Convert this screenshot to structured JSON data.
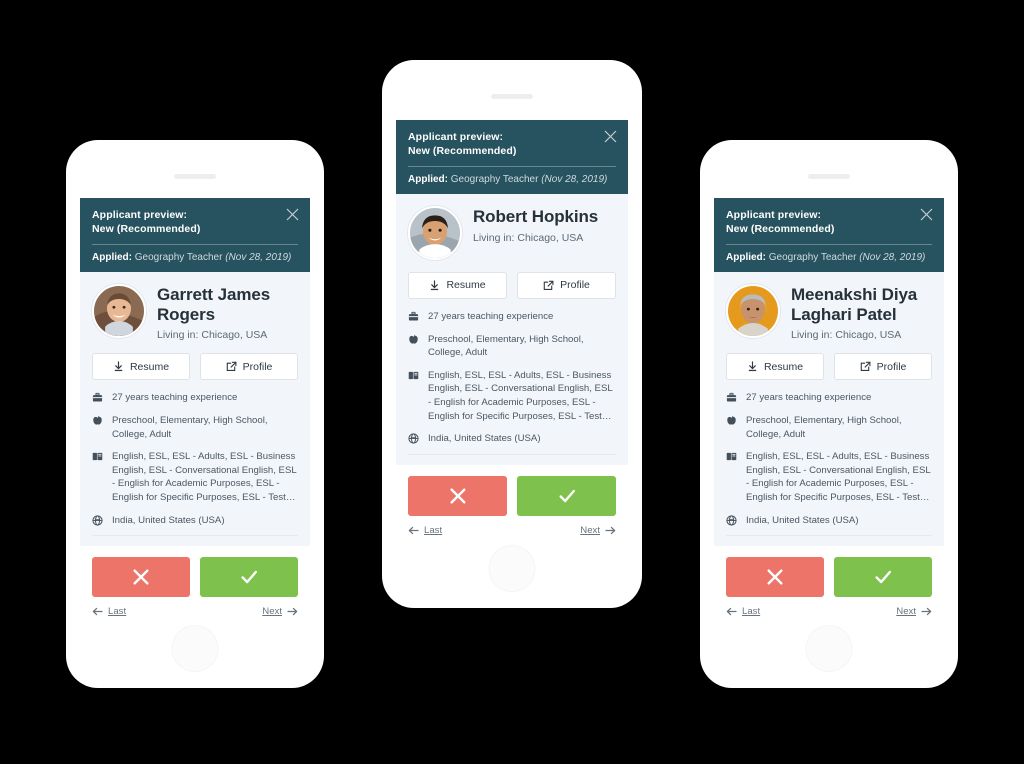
{
  "header": {
    "title": "Applicant preview:\nNew (Recommended)",
    "close_icon": "close-icon",
    "applied_label": "Applied:",
    "applied_role": "Geography Teacher",
    "applied_date": "(Nov 28, 2019)",
    "bg_color": "#27525f"
  },
  "buttons": {
    "resume_label": "Resume",
    "resume_icon": "download-icon",
    "profile_label": "Profile",
    "profile_icon": "external-link-icon"
  },
  "decision": {
    "reject_icon": "cross-icon",
    "reject_color": "#ed7469",
    "accept_icon": "check-icon",
    "accept_color": "#7ec24d"
  },
  "pager": {
    "last_label": "Last",
    "last_icon": "arrow-left-icon",
    "next_label": "Next",
    "next_icon": "arrow-right-icon"
  },
  "details_icons": {
    "experience": "briefcase-icon",
    "levels": "apple-icon",
    "subjects": "book-icon",
    "countries": "globe-icon"
  },
  "phones": [
    {
      "id": "left",
      "name": "Garrett James Rogers",
      "location": "Living in: Chicago, USA",
      "avatar": "male-brown-hair-avatar",
      "details": {
        "experience": "27 years teaching experience",
        "levels": "Preschool, Elementary, High School, College, Adult",
        "subjects": "English, ESL, ESL - Adults, ESL - Business English, ESL - Conversational English, ESL - English for Academic Purposes, ESL - English for Specific Purposes, ESL - Test…",
        "countries": "India, United States (USA)"
      }
    },
    {
      "id": "center",
      "name": "Robert Hopkins",
      "location": "Living in: Chicago, USA",
      "avatar": "male-dark-hair-avatar",
      "details": {
        "experience": "27 years teaching experience",
        "levels": "Preschool, Elementary, High School, College, Adult",
        "subjects": "English, ESL, ESL - Adults, ESL - Business English, ESL - Conversational English, ESL - English for Academic Purposes, ESL - English for Specific Purposes, ESL - Test…",
        "countries": "India, United States (USA)"
      }
    },
    {
      "id": "right",
      "name": "Meenakshi Diya Laghari Patel",
      "location": "Living in: Chicago, USA",
      "avatar": "female-gray-hair-avatar",
      "details": {
        "experience": "27 years teaching experience",
        "levels": "Preschool, Elementary, High School, College, Adult",
        "subjects": "English, ESL, ESL - Adults, ESL - Business English, ESL - Conversational English, ESL - English for Academic Purposes, ESL - English for Specific Purposes, ESL - Test…",
        "countries": "India, United States (USA)"
      }
    }
  ]
}
